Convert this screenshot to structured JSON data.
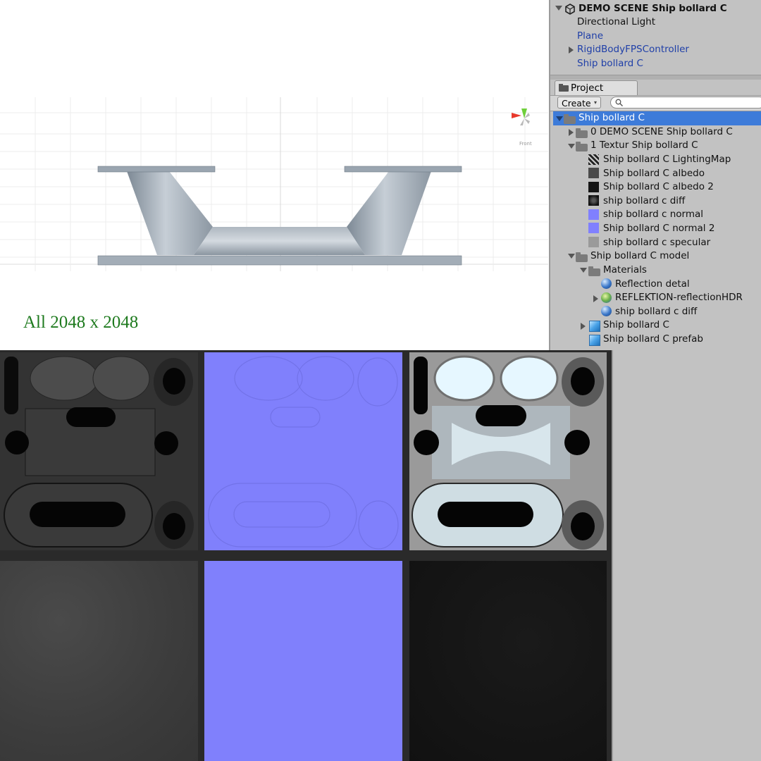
{
  "caption": "All 2048 x 2048",
  "hierarchy": {
    "root": "DEMO SCENE Ship bollard C",
    "items": [
      {
        "label": "Directional Light"
      },
      {
        "label": "Plane"
      },
      {
        "label": "RigidBodyFPSController"
      },
      {
        "label": "Ship bollard C"
      }
    ]
  },
  "gizmo_label": "Front",
  "project": {
    "tab_label": "Project",
    "create_label": "Create",
    "search_placeholder": "",
    "tree": [
      {
        "label": "Ship bollard C",
        "icon": "folder-icon"
      },
      {
        "label": "0 DEMO SCENE Ship bollard C",
        "icon": "folder-icon"
      },
      {
        "label": "1 Textur Ship bollard C",
        "icon": "folder-icon"
      },
      {
        "label": "Ship bollard C  LightingMap",
        "icon": "texture-icon"
      },
      {
        "label": "Ship bollard C albedo",
        "icon": "texture-icon"
      },
      {
        "label": "Ship bollard C albedo 2",
        "icon": "texture-icon"
      },
      {
        "label": "ship bollard c diff",
        "icon": "texture-icon"
      },
      {
        "label": "ship bollard c normal",
        "icon": "texture-icon"
      },
      {
        "label": "Ship bollard C normal 2",
        "icon": "texture-icon"
      },
      {
        "label": "ship bollard c specular",
        "icon": "texture-icon"
      },
      {
        "label": "Ship bollard C  model",
        "icon": "folder-icon"
      },
      {
        "label": "Materials",
        "icon": "folder-icon"
      },
      {
        "label": "Reflection detal",
        "icon": "material-sphere-icon"
      },
      {
        "label": "REFLEKTION-reflectionHDR",
        "icon": "material-sphere-icon"
      },
      {
        "label": "ship bollard c diff",
        "icon": "material-sphere-icon"
      },
      {
        "label": "Ship bollard C",
        "icon": "model-cube-icon"
      },
      {
        "label": "Ship bollard C prefab",
        "icon": "prefab-cube-icon"
      }
    ]
  },
  "colors": {
    "selection": "#3d7bd9",
    "panel": "#c2c2c2",
    "normal_map": "#8080ff",
    "caption": "#1e7a1e"
  }
}
